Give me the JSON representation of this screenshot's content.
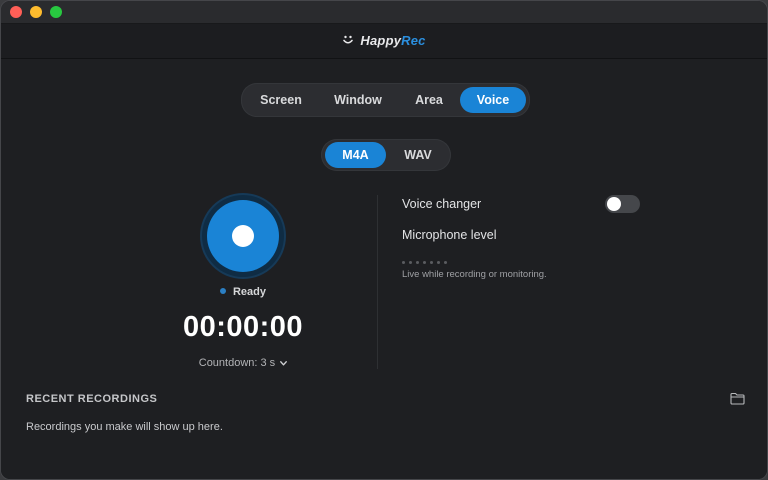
{
  "window": {
    "colors": {
      "close": "#ff5f57",
      "minimize": "#febc2e",
      "maximize": "#28c840"
    }
  },
  "app": {
    "brand_main": "Happy",
    "brand_accent": "Rec",
    "logo_icon": "smile-icon",
    "accent_color": "#1a84d6"
  },
  "modes": {
    "options": [
      "Screen",
      "Window",
      "Area",
      "Voice"
    ],
    "selected": "Voice"
  },
  "formats": {
    "options": [
      "M4A",
      "WAV"
    ],
    "selected": "M4A"
  },
  "recorder": {
    "status": "Ready",
    "timer": "00:00:00",
    "countdown_label": "Countdown: 3 s",
    "chevron_icon": "chevron-down-icon"
  },
  "settings": {
    "voice_changer_label": "Voice changer",
    "voice_changer_on": false,
    "mic_level_label": "Microphone level",
    "mic_hint": "Live while recording or monitoring."
  },
  "recent": {
    "title": "RECENT RECORDINGS",
    "empty_text": "Recordings you make will show up here.",
    "folder_icon": "folder-icon"
  }
}
